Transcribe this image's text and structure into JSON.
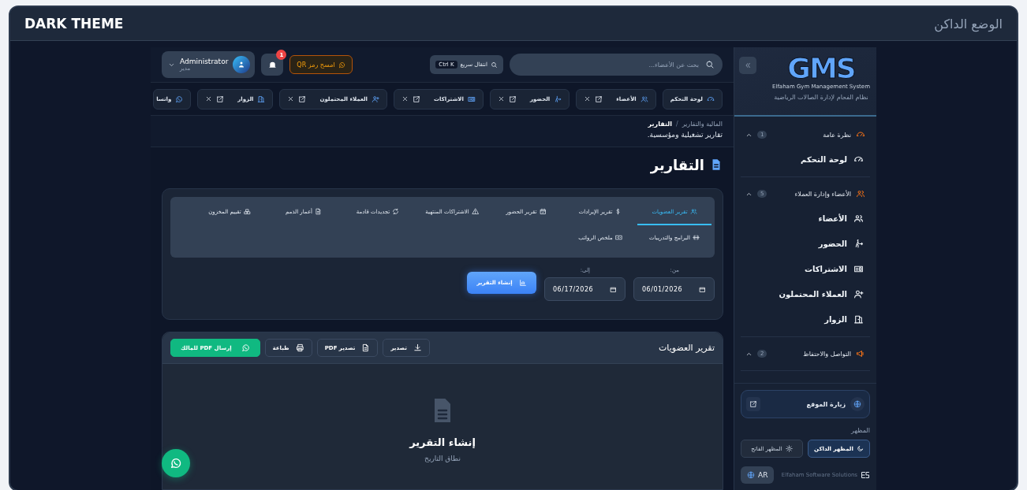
{
  "frame": {
    "title": "DARK THEME",
    "subtitle": "الوضع الداكن"
  },
  "sidebar": {
    "logo_text": "GMS",
    "logo_caption": "Elfaham Gym Management System",
    "system_name": "نظام الفحام لإدارة الصالات الرياضية",
    "groups": [
      {
        "label": "نظرة عامة",
        "count": "1",
        "expanded": true,
        "items": [
          {
            "label": "لوحة التحكم"
          }
        ]
      },
      {
        "label": "الأعضاء وإدارة العملاء",
        "count": "5",
        "expanded": true,
        "items": [
          {
            "label": "الأعضاء"
          },
          {
            "label": "الحضور"
          },
          {
            "label": "الاشتراكات"
          },
          {
            "label": "العملاء المحتملون"
          },
          {
            "label": "الزوار"
          }
        ]
      },
      {
        "label": "التواصل والاحتفاظ",
        "count": "2",
        "expanded": true
      }
    ],
    "visit_site": "زيارة الموقع",
    "appearance_label": "المظهر",
    "themes": [
      {
        "label": "المظهر الداكن",
        "selected": true
      },
      {
        "label": "المظهر الفاتح",
        "selected": false
      }
    ],
    "language": "AR",
    "vendor": "Elfaham Software Solutions"
  },
  "topbar": {
    "search_placeholder": "بحث عن الأعضاء...",
    "quick_jump": "انتقال سريع",
    "shortcut": "Ctrl K",
    "qr_button": "امسح رمز QR",
    "notifications": "1",
    "user_name": "Administrator",
    "user_role": "مدير"
  },
  "open_tabs": [
    {
      "label": "لوحة التحكم",
      "kind": "pinned"
    },
    {
      "label": "الأعضاء",
      "kind": "closable"
    },
    {
      "label": "الحضور",
      "kind": "closable"
    },
    {
      "label": "الاشتراكات",
      "kind": "closable"
    },
    {
      "label": "العملاء المحتملون",
      "kind": "closable"
    },
    {
      "label": "الزوار",
      "kind": "closable"
    },
    {
      "label": "واتسا",
      "kind": "cut"
    }
  ],
  "breadcrumb": [
    "المالية والتقارير",
    "التقارير"
  ],
  "breadcrumb_separator": "/",
  "page_subtitle": "تقارير تشغيلية ومؤسسية.",
  "page_title": "التقارير",
  "report_tabs": [
    {
      "label": "تقرير العضويات",
      "selected": true
    },
    {
      "label": "تقرير الإيرادات",
      "selected": false
    },
    {
      "label": "تقرير الحضور",
      "selected": false
    },
    {
      "label": "الاشتراكات المنتهية",
      "selected": false
    },
    {
      "label": "تجديدات قادمة",
      "selected": false
    },
    {
      "label": "أعمار الذمم",
      "selected": false
    },
    {
      "label": "تقييم المخزون",
      "selected": false
    },
    {
      "label": "البرامج والتدريبات",
      "selected": false
    },
    {
      "label": "ملخص الرواتب",
      "selected": false
    }
  ],
  "date_from": {
    "label": "من:",
    "value": "06/01/2026"
  },
  "date_to": {
    "label": "إلى:",
    "value": "06/17/2026"
  },
  "generate_button": "إنشاء التقرير",
  "result": {
    "title": "تقرير العضويات",
    "actions": [
      {
        "label": "تصدير",
        "kind": "plain"
      },
      {
        "label": "تصدير PDF",
        "kind": "plain"
      },
      {
        "label": "طباعة",
        "kind": "plain"
      },
      {
        "label": "إرسال PDF للمالك",
        "kind": "whatsapp"
      }
    ],
    "empty_title": "إنشاء التقرير",
    "empty_text": "نطاق التاريخ"
  }
}
